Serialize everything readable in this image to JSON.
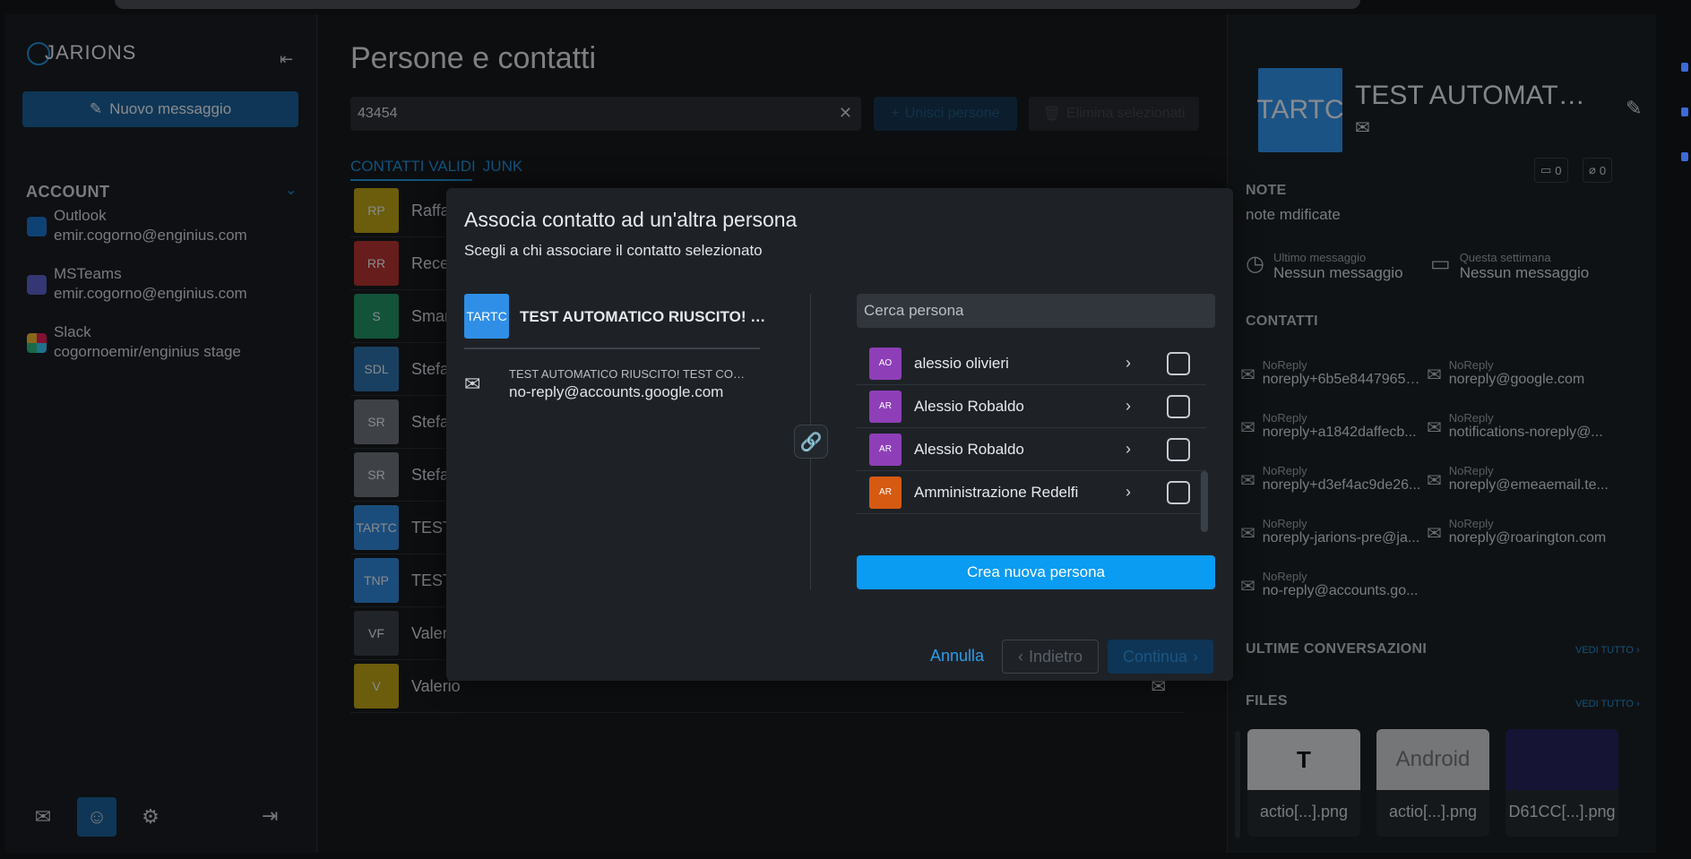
{
  "app": {
    "logo": "JARIONS"
  },
  "sidebar": {
    "new_message": "Nuovo messaggio",
    "account_header": "ACCOUNT",
    "accounts": [
      {
        "name": "Outlook",
        "address": "emir.cogorno@enginius.com"
      },
      {
        "name": "MSTeams",
        "address": "emir.cogorno@enginius.com"
      },
      {
        "name": "Slack",
        "address": "cogornoemir/enginius stage"
      }
    ]
  },
  "main": {
    "title": "Persone e contatti",
    "search_value": "43454",
    "merge_button": "Unisci persone",
    "delete_button": "Elimina selezionati",
    "tabs": [
      "CONTATTI VALIDI",
      "JUNK"
    ],
    "contacts": [
      {
        "initials": "RP",
        "name": "Raffaele",
        "color": "#b8a114"
      },
      {
        "initials": "RR",
        "name": "Recep",
        "color": "#b0332f"
      },
      {
        "initials": "S",
        "name": "Smart",
        "color": "#1f8f63"
      },
      {
        "initials": "SDL",
        "name": "Stefan",
        "color": "#2b6ea8"
      },
      {
        "initials": "SR",
        "name": "Stefan",
        "color": "#6b7177"
      },
      {
        "initials": "SR",
        "name": "Stefan",
        "color": "#6b7177"
      },
      {
        "initials": "TARTC",
        "name": "TEST A",
        "color": "#2f86d6"
      },
      {
        "initials": "TNP",
        "name": "TEST N",
        "color": "#2f86d6"
      },
      {
        "initials": "VF",
        "name": "Valentina Fistarol",
        "color": "#3a3f46"
      },
      {
        "initials": "V",
        "name": "Valerio",
        "color": "#b8a114"
      }
    ]
  },
  "detail": {
    "avatar": "TARTC",
    "name": "TEST AUTOMATICO RIUSCITO!",
    "comments": "0",
    "attachments": "0",
    "notes_header": "NOTE",
    "notes": "note mdificate",
    "last_message_label": "Ultimo messaggio",
    "last_message_value": "Nessun messaggio",
    "week_label": "Questa settimana",
    "week_value": "Nessun messaggio",
    "contacts_header": "CONTATTI",
    "contacts": [
      {
        "label": "NoReply",
        "value": "noreply+6b5e8447965d..."
      },
      {
        "label": "NoReply",
        "value": "noreply@google.com"
      },
      {
        "label": "NoReply",
        "value": "noreply+a1842daffecb..."
      },
      {
        "label": "NoReply",
        "value": "notifications-noreply@..."
      },
      {
        "label": "NoReply",
        "value": "noreply+d3ef4ac9de26..."
      },
      {
        "label": "NoReply",
        "value": "noreply@emeaemail.te..."
      },
      {
        "label": "NoReply",
        "value": "noreply-jarions-pre@ja..."
      },
      {
        "label": "NoReply",
        "value": "noreply@roarington.com"
      },
      {
        "label": "NoReply",
        "value": "no-reply@accounts.go..."
      }
    ],
    "conversations_header": "ULTIME CONVERSAZIONI",
    "see_all": "VEDI TUTTO",
    "files_header": "FILES",
    "files": [
      {
        "name": "actio[...].png",
        "preview": "T"
      },
      {
        "name": "actio[...].png",
        "preview": "Android"
      },
      {
        "name": "D61CC[...].png",
        "preview": ""
      }
    ]
  },
  "modal": {
    "title": "Associa contatto ad un'altra persona",
    "subtitle": "Scegli a chi associare il contatto selezionato",
    "selected_avatar": "TARTC",
    "selected_name": "TEST AUTOMATICO RIUSCITO! TE...",
    "selected_mail_subject": "TEST AUTOMATICO RIUSCITO! TEST COG...",
    "selected_mail": "no-reply@accounts.google.com",
    "search_placeholder": "Cerca persona",
    "people": [
      {
        "initials": "AO",
        "name": "alessio olivieri",
        "color": "#8e3fb8"
      },
      {
        "initials": "AR",
        "name": "Alessio Robaldo",
        "color": "#8e3fb8"
      },
      {
        "initials": "AR",
        "name": "Alessio Robaldo",
        "color": "#8e3fb8"
      },
      {
        "initials": "AR",
        "name": "Amministrazione Redelfi",
        "color": "#d65a12"
      }
    ],
    "create_button": "Crea nuova persona",
    "cancel": "Annulla",
    "back": "Indietro",
    "continue": "Continua"
  }
}
